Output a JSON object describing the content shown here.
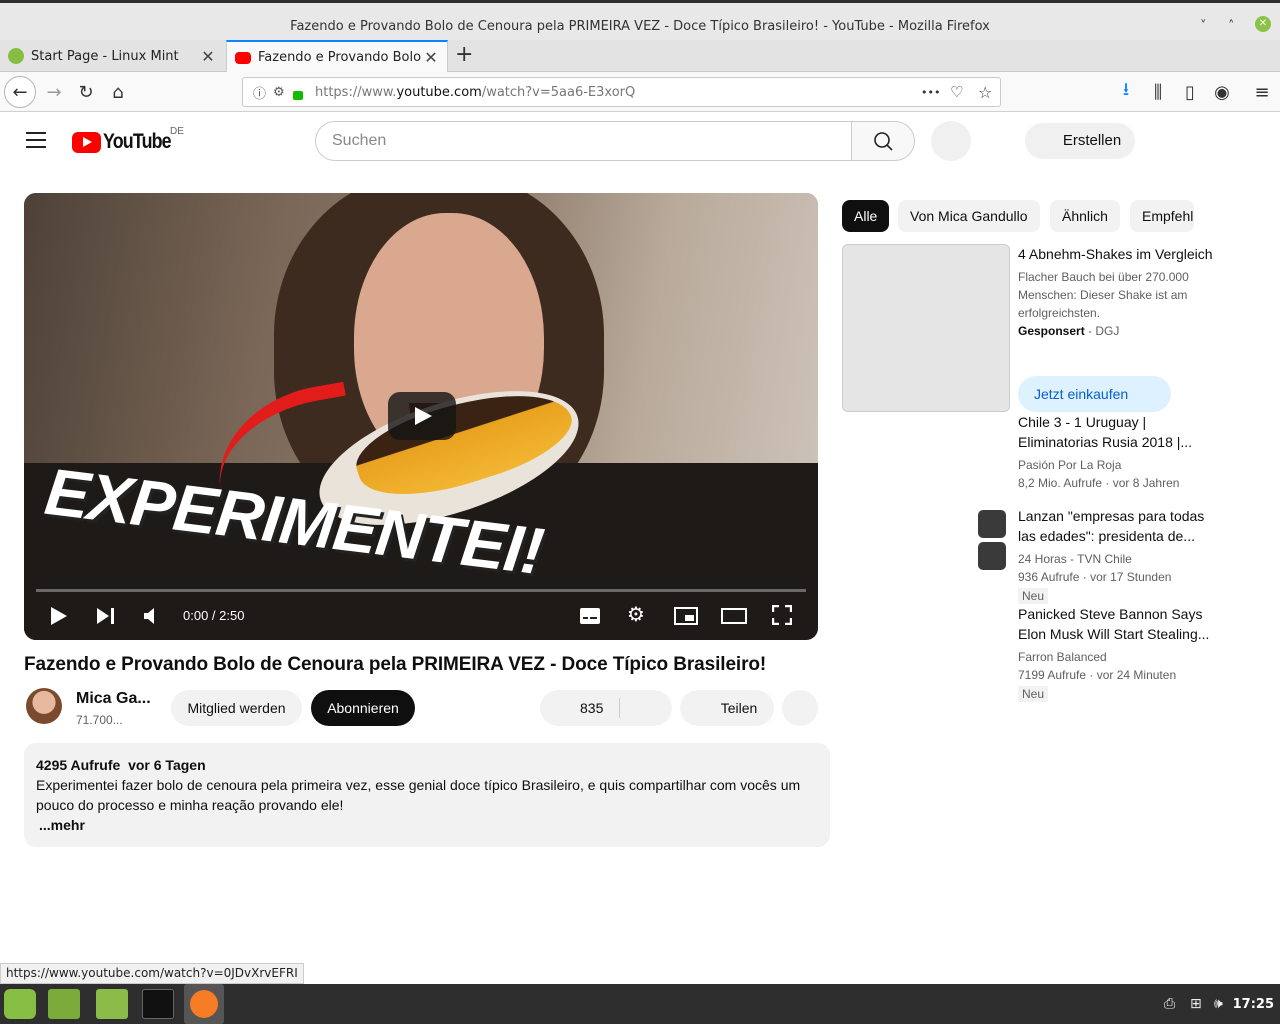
{
  "window": {
    "title": "Fazendo e Provando Bolo de Cenoura pela PRIMEIRA VEZ - Doce Típico Brasileiro! - YouTube - Mozilla Firefox",
    "minimize": "˅",
    "maximize": "˄",
    "close": "✕"
  },
  "tabs": [
    {
      "label": "Start Page - Linux Mint",
      "close": "✕",
      "favicon_color": "#86be43"
    },
    {
      "label": "Fazendo e Provando Bolo de Cenoura pela PRIMEIRA VEZ",
      "close": "✕",
      "favicon_color": "#ff0000"
    }
  ],
  "newtab": "+",
  "nav": {
    "back": "←",
    "forward": "→",
    "reload": "↻",
    "home": "⌂",
    "url_prefix": "https://www.",
    "url_domain": "youtube.com",
    "url_path": "/watch?v=5aa6-E3xorQ",
    "more": "•••",
    "pocket": "♡",
    "star": "☆",
    "download": "⭳",
    "library": "⫼",
    "sidebar": "▯",
    "account": "◉",
    "menu": "≡"
  },
  "yt": {
    "logo_text": "YouTube",
    "region": "DE",
    "search_placeholder": "Suchen",
    "search_icon": "⌕",
    "create_label": "Erstellen"
  },
  "video": {
    "thumb_text": "EXPERIMENTEI!",
    "time": "0:00 / 2:50",
    "title": "Fazendo e Provando Bolo de Cenoura pela PRIMEIRA VEZ - Doce Típico Brasileiro!",
    "channel": "Mica Ga...",
    "subscribers": "71.700...",
    "member_label": "Mitglied werden",
    "subscribe_label": "Abonnieren",
    "likes": "835",
    "share_label": "Teilen",
    "progress": 0.0
  },
  "description": {
    "views": "4295 Aufrufe",
    "age": "vor 6 Tagen",
    "text": "Experimentei fazer bolo de cenoura pela primeira vez, esse genial doce típico Brasileiro, e quis compartilhar com vocês um pouco do processo e minha reação provando ele!",
    "more": "...mehr"
  },
  "chips": [
    "Alle",
    "Von Mica Gandullo",
    "Ähnlich",
    "Empfehlungen"
  ],
  "ad": {
    "title": "4 Abnehm-Shakes im Vergleich",
    "text": "Flacher Bauch bei über 270.000 Menschen: Dieser Shake ist am erfolgreichsten.",
    "sponsored": "Gesponsert",
    "advertiser": "DGJ",
    "cta": "Jetzt einkaufen"
  },
  "related": [
    {
      "title": "Chile 3 - 1 Uruguay | Eliminatorias Rusia 2018 |...",
      "channel": "Pasión Por La Roja",
      "views": "8,2 Mio. Aufrufe",
      "age": "vor 8 Jahren",
      "badge": ""
    },
    {
      "title": "Lanzan \"empresas para todas las edades\": presidenta de...",
      "channel": "24 Horas - TVN Chile",
      "views": "936 Aufrufe",
      "age": "vor 17 Stunden",
      "badge": "Neu"
    },
    {
      "title": "Panicked Steve Bannon Says Elon Musk Will Start Stealing...",
      "channel": "Farron Balanced",
      "views": "7199 Aufrufe",
      "age": "vor 24 Minuten",
      "badge": "Neu"
    }
  ],
  "statusbar": {
    "link": "https://www.youtube.com/watch?v=0JDvXrvEFRI"
  },
  "taskbar": {
    "clock": "17:25"
  }
}
